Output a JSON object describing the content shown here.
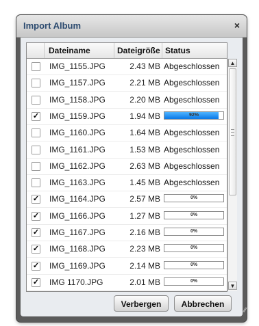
{
  "dialog": {
    "title": "Import Album",
    "close_glyph": "×"
  },
  "table": {
    "columns": [
      "Dateiname",
      "Dateigröße",
      "Status"
    ],
    "rows": [
      {
        "checked": false,
        "check_glyph": "",
        "name": "IMG_1155.JPG",
        "size": "2.43 MB",
        "status": "Abgeschlossen"
      },
      {
        "checked": false,
        "check_glyph": "",
        "name": "IMG_1157.JPG",
        "size": "2.21 MB",
        "status": "Abgeschlossen"
      },
      {
        "checked": false,
        "check_glyph": "",
        "name": "IMG_1158.JPG",
        "size": "2.20 MB",
        "status": "Abgeschlossen"
      },
      {
        "checked": true,
        "check_glyph": "✓",
        "name": "IMG_1159.JPG",
        "size": "1.94 MB",
        "progress": 0.92,
        "progress_label": "92%"
      },
      {
        "checked": false,
        "check_glyph": "",
        "name": "IMG_1160.JPG",
        "size": "1.64 MB",
        "status": "Abgeschlossen"
      },
      {
        "checked": false,
        "check_glyph": "",
        "name": "IMG_1161.JPG",
        "size": "1.53 MB",
        "status": "Abgeschlossen"
      },
      {
        "checked": false,
        "check_glyph": "",
        "name": "IMG_1162.JPG",
        "size": "2.63 MB",
        "status": "Abgeschlossen"
      },
      {
        "checked": false,
        "check_glyph": "",
        "name": "IMG_1163.JPG",
        "size": "1.45 MB",
        "status": "Abgeschlossen"
      },
      {
        "checked": true,
        "check_glyph": "✓",
        "name": "IMG_1164.JPG",
        "size": "2.57 MB",
        "progress": 0,
        "progress_label": "0%"
      },
      {
        "checked": true,
        "check_glyph": "✓",
        "name": "IMG_1166.JPG",
        "size": "1.27 MB",
        "progress": 0,
        "progress_label": "0%"
      },
      {
        "checked": true,
        "check_glyph": "✓",
        "name": "IMG_1167.JPG",
        "size": "2.16 MB",
        "progress": 0,
        "progress_label": "0%"
      },
      {
        "checked": true,
        "check_glyph": "✓",
        "name": "IMG_1168.JPG",
        "size": "2.23 MB",
        "progress": 0,
        "progress_label": "0%"
      },
      {
        "checked": true,
        "check_glyph": "✓",
        "name": "IMG_1169.JPG",
        "size": "2.14 MB",
        "progress": 0,
        "progress_label": "0%"
      },
      {
        "checked": true,
        "check_glyph": "✓",
        "name": "IMG 1170.JPG",
        "size": "2.01 MB",
        "progress": 0,
        "progress_label": "0%"
      }
    ]
  },
  "scrollbar": {
    "up_glyph": "▲",
    "down_glyph": "▼"
  },
  "buttons": {
    "hide_label": "Verbergen",
    "cancel_label": "Abbrechen"
  },
  "resize_glyph": "⁄⁄",
  "colors": {
    "progress_fill": "#1787f0",
    "title_text": "#2b4a6f",
    "frame": "#5b5b5b"
  }
}
